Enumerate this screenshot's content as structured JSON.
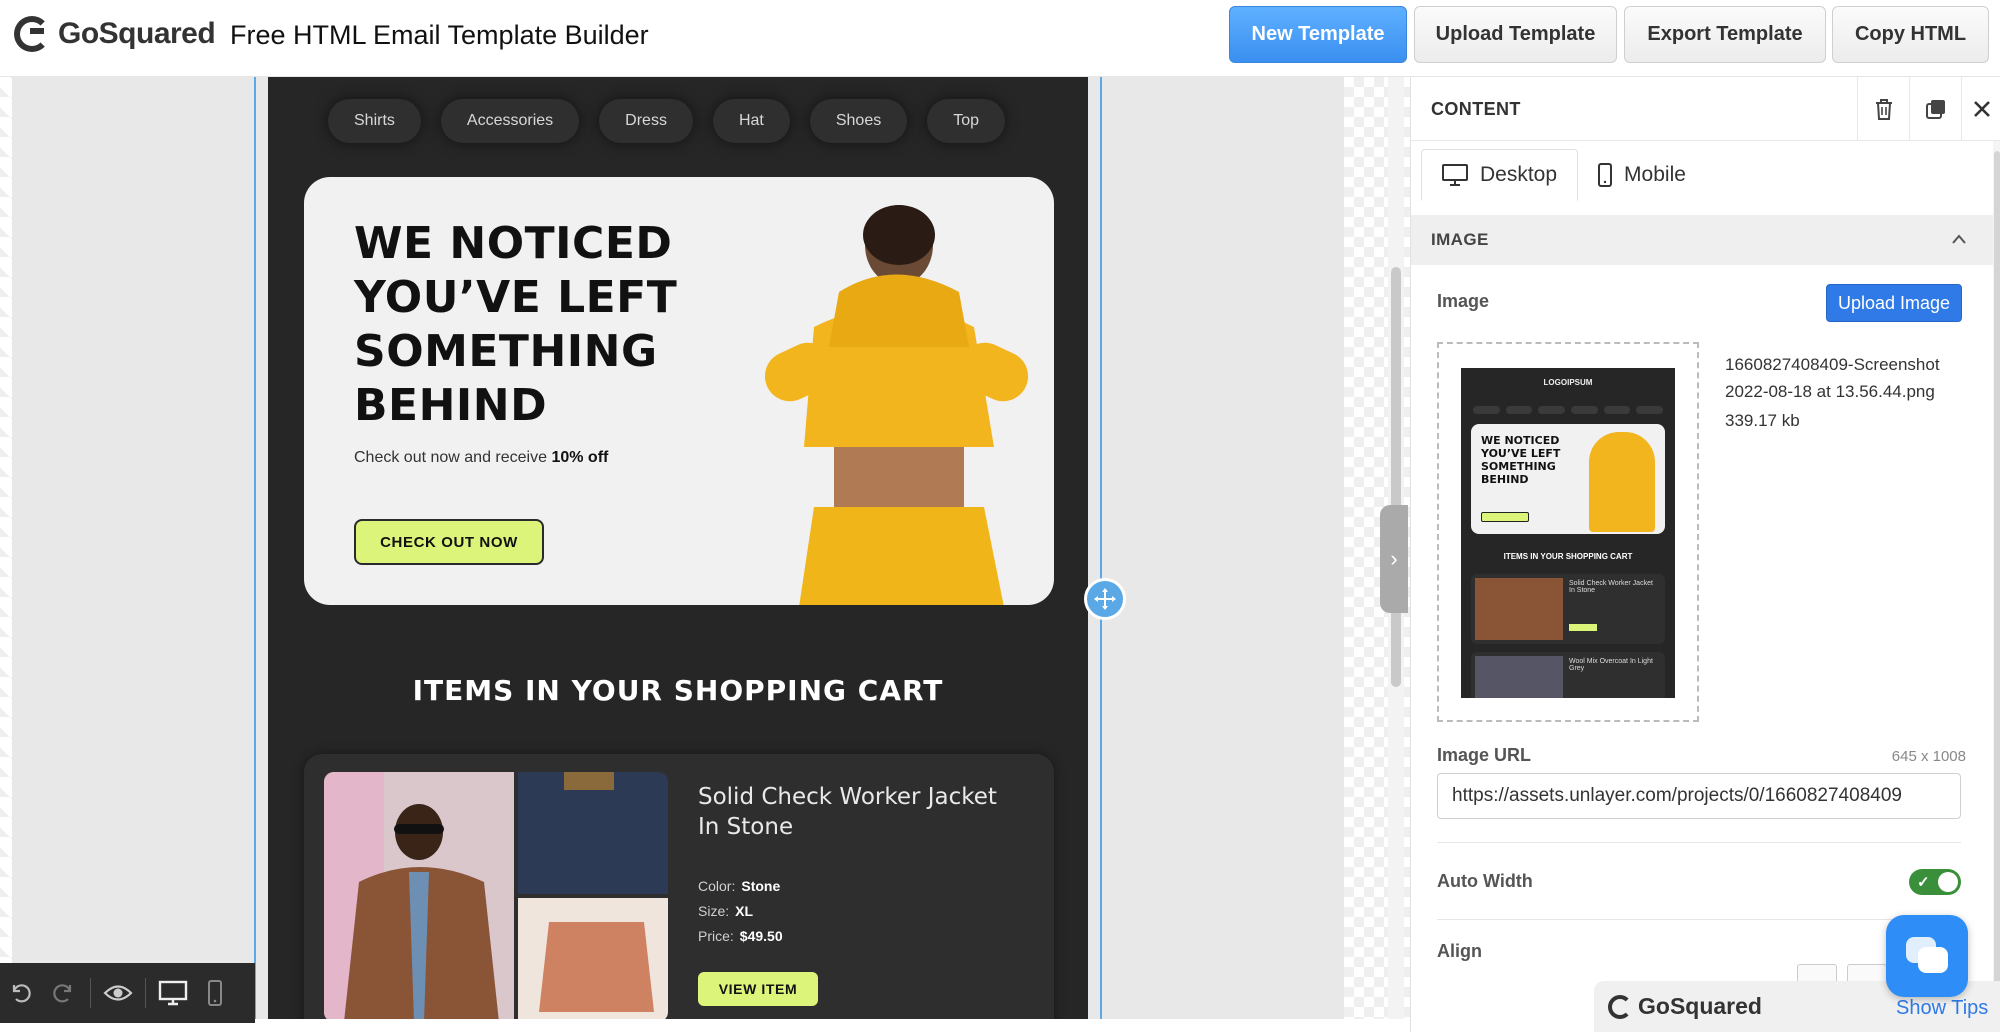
{
  "header": {
    "logo_text": "GoSquared",
    "app_title": "Free HTML Email Template Builder",
    "buttons": {
      "new_template": "New Template",
      "upload_template": "Upload Template",
      "export_template": "Export Template",
      "copy_html": "Copy HTML"
    }
  },
  "email": {
    "categories": [
      "Shirts",
      "Accessories",
      "Dress",
      "Hat",
      "Shoes",
      "Top"
    ],
    "hero": {
      "headline": "WE NOTICED YOU’VE LEFT SOMETHING BEHIND",
      "subtext_prefix": "Check out now and receive",
      "subtext_bold": "10% off",
      "button": "CHECK OUT NOW"
    },
    "cart_title": "ITEMS IN YOUR SHOPPING CART",
    "item": {
      "name": "Solid Check Worker Jacket In Stone",
      "color_label": "Color:",
      "color_value": "Stone",
      "size_label": "Size:",
      "size_value": "XL",
      "price_label": "Price:",
      "price_value": "$49.50",
      "button": "VIEW ITEM"
    }
  },
  "toolbar": {
    "icons": [
      "undo-icon",
      "redo-icon",
      "preview-eye-icon",
      "desktop-icon",
      "mobile-icon"
    ]
  },
  "panel": {
    "title": "CONTENT",
    "tabs": {
      "desktop": "Desktop",
      "mobile": "Mobile"
    },
    "section_title": "IMAGE",
    "image_label": "Image",
    "upload_button": "Upload Image",
    "file_name": "1660827408409-Screenshot 2022-08-18 at 13.56.44.png",
    "file_size": "339.17 kb",
    "thumb": {
      "logo": "LOGOIPSUM",
      "headline": "WE NOTICED YOU’VE LEFT SOMETHING BEHIND",
      "cart_title": "ITEMS IN YOUR SHOPPING CART",
      "item1": "Solid Check Worker Jacket In Stone",
      "item2": "Wool Mix Overcoat In Light Grey"
    },
    "image_url_label": "Image URL",
    "image_dimensions": "645 x 1008",
    "image_url_value": "https://assets.unlayer.com/projects/0/1660827408409",
    "auto_width_label": "Auto Width",
    "auto_width_on": true,
    "align_label": "Align"
  },
  "footer": {
    "brand": "GoSquared",
    "show_tips": "Show Tips"
  },
  "colors": {
    "primary_blue": "#3a8ff0",
    "accent_lime": "#dcf47a",
    "email_bg": "#262626",
    "selection": "#5aa8e6"
  }
}
